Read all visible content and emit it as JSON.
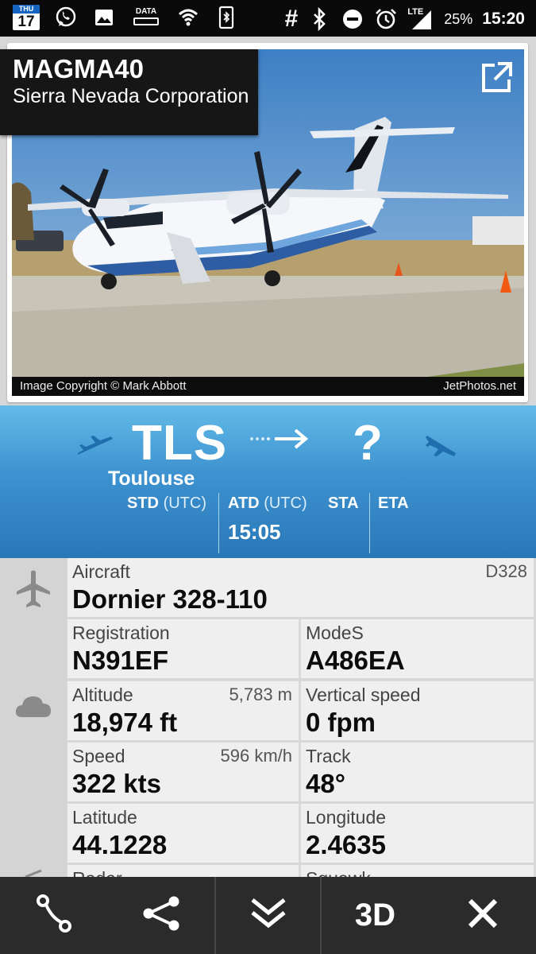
{
  "status_bar": {
    "day": "THU",
    "date": "17",
    "data_label": "DATA",
    "hash": "#",
    "network": "LTE",
    "battery": "25%",
    "time": "15:20"
  },
  "photo": {
    "callsign": "MAGMA40",
    "airline": "Sierra Nevada Corporation",
    "copyright": "Image Copyright © Mark Abbott",
    "source": "JetPhotos.net",
    "icon": "external-link-icon"
  },
  "route": {
    "origin_code": "TLS",
    "origin_name": "Toulouse",
    "destination_code": "?",
    "std_label": "STD",
    "std_unit": "(UTC)",
    "atd_label": "ATD",
    "atd_unit": "(UTC)",
    "atd_value": "15:05",
    "sta_label": "STA",
    "eta_label": "ETA"
  },
  "details": {
    "aircraft": {
      "label": "Aircraft",
      "value": "Dornier 328-110",
      "code": "D328"
    },
    "registration": {
      "label": "Registration",
      "value": "N391EF"
    },
    "modes": {
      "label": "ModeS",
      "value": "A486EA"
    },
    "altitude": {
      "label": "Altitude",
      "value": "18,974 ft",
      "sub": "5,783 m"
    },
    "vertical_speed": {
      "label": "Vertical speed",
      "value": "0 fpm"
    },
    "speed": {
      "label": "Speed",
      "value": "322 kts",
      "sub": "596 km/h"
    },
    "track": {
      "label": "Track",
      "value": "48°"
    },
    "latitude": {
      "label": "Latitude",
      "value": "44.1228"
    },
    "longitude": {
      "label": "Longitude",
      "value": "2.4635"
    },
    "radar": {
      "label": "Radar"
    },
    "squawk": {
      "label": "Squawk"
    }
  },
  "toolbar": {
    "route_icon": "route-icon",
    "share_icon": "share-icon",
    "collapse_icon": "chevrons-down-icon",
    "three_d_label": "3D",
    "close_icon": "close-icon"
  },
  "colors": {
    "route_band_top": "#63bbe8",
    "route_band_bottom": "#2a77b7",
    "toolbar_bg": "#2b2b2b",
    "status_bar_bg": "#0a0a0a"
  }
}
